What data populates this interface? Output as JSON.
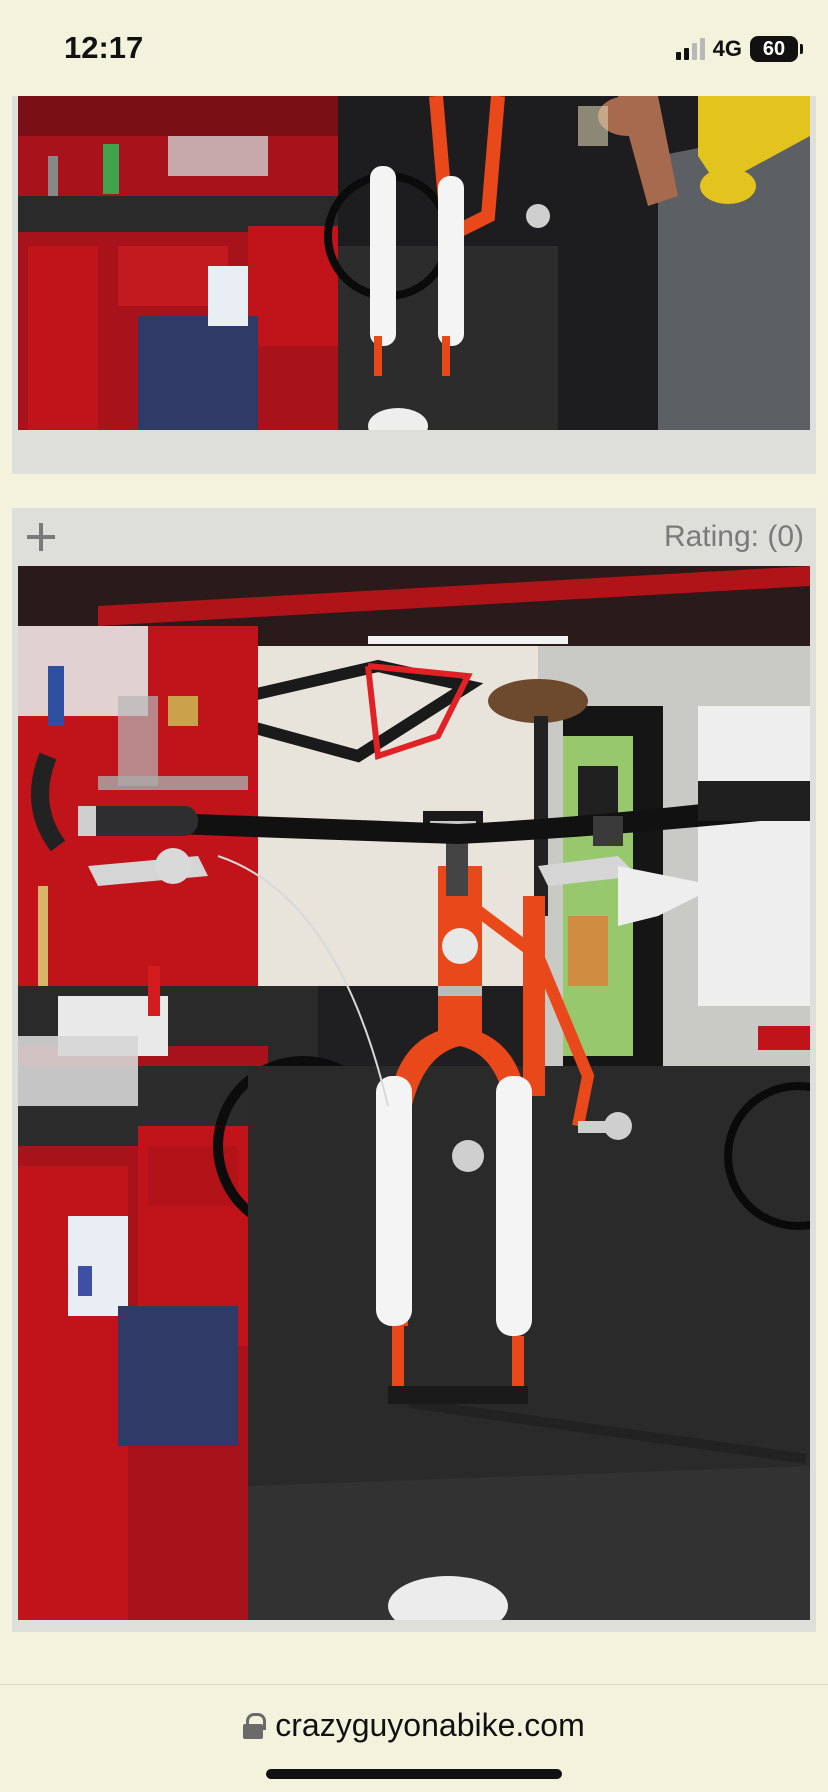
{
  "status_bar": {
    "time": "12:17",
    "network": "4G",
    "battery": "60"
  },
  "cards": [
    {
      "image_alt": "bike-fork-workshop-photo-top"
    },
    {
      "image_alt": "bike-handlebars-fork-workshop-photo",
      "rating_label": "Rating: (0)"
    }
  ],
  "address_bar": {
    "url": "crazyguyonabike.com"
  },
  "colors": {
    "page_bg": "#f3f3dd",
    "card_bg": "#dededa",
    "bike_orange": "#e8481a",
    "workbench_red": "#c0141a",
    "text_gray": "#7a7a7a"
  }
}
